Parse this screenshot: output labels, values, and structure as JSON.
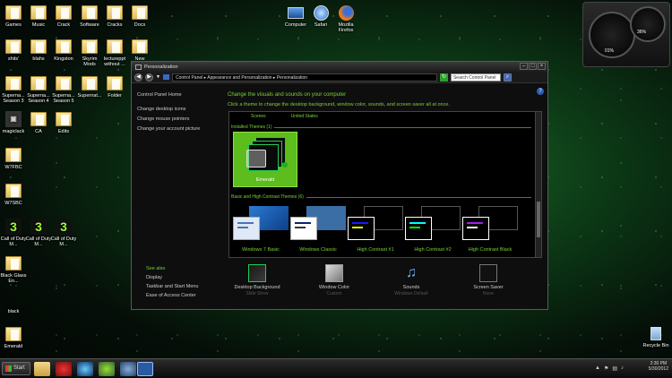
{
  "desktop": {
    "icons": [
      {
        "label": "Games"
      },
      {
        "label": "Music"
      },
      {
        "label": "Crack"
      },
      {
        "label": "Software"
      },
      {
        "label": "Cracks"
      },
      {
        "label": "Docs"
      },
      {
        "label": "shits'"
      },
      {
        "label": "blahs"
      },
      {
        "label": "Kingston"
      },
      {
        "label": "Skyrim Mods"
      },
      {
        "label": "lectureppt without ..."
      },
      {
        "label": "New"
      },
      {
        "label": "Superna... Season 3"
      },
      {
        "label": "Superna... Season 4"
      },
      {
        "label": "Superna... Season 5"
      },
      {
        "label": "Supernat..."
      },
      {
        "label": "Folder"
      },
      {
        "label": "In"
      },
      {
        "label": "magiclack"
      },
      {
        "label": "CA"
      },
      {
        "label": "Edits"
      },
      {
        "label": "W7FBC"
      },
      {
        "label": "W7SBC"
      },
      {
        "label": "Call of Duty M..."
      },
      {
        "label": "Call of Duty M..."
      },
      {
        "label": "Call of Duty M..."
      },
      {
        "label": "Black Glass En..."
      },
      {
        "label": "black"
      },
      {
        "label": "Emerald"
      }
    ],
    "top_apps": [
      {
        "label": "Computer"
      },
      {
        "label": "Safari"
      },
      {
        "label": "Mozilla Firefox"
      }
    ],
    "recycle_bin": "Recycle Bin"
  },
  "gadget": {
    "cpu_pct": "01%",
    "mem_pct": "36%"
  },
  "window": {
    "title": "Personalization",
    "address": "Control Panel  ▸  Appearance and Personalization  ▸  Personalization",
    "search_placeholder": "Search Control Panel",
    "left_pane": {
      "home": "Control Panel Home",
      "links": [
        "Change desktop icons",
        "Change mouse pointers",
        "Change your account picture"
      ]
    },
    "see_also": {
      "heading": "See also",
      "links": [
        "Display",
        "Taskbar and Start Menu",
        "Ease of Access Center"
      ]
    },
    "heading": "Change the visuals and sounds on your computer",
    "subheading": "Click a theme to change the desktop background, window color, sounds, and screen saver all at once.",
    "top_labels": [
      "Scenes",
      "United States"
    ],
    "installed_header": "Installed Themes (1)",
    "installed_theme": "Emerald",
    "basic_header": "Basic and High Contrast Themes (6)",
    "basic_themes": [
      {
        "label": "Windows 7 Basic"
      },
      {
        "label": "Windows Classic"
      },
      {
        "label": "High Contrast #1"
      },
      {
        "label": "High Contrast #2"
      },
      {
        "label": "High Contrast Black"
      }
    ],
    "bottom": [
      {
        "label": "Desktop Background",
        "sub": "Slide Show"
      },
      {
        "label": "Window Color",
        "sub": "Custom"
      },
      {
        "label": "Sounds",
        "sub": "Windows Default"
      },
      {
        "label": "Screen Saver",
        "sub": "None"
      }
    ]
  },
  "taskbar": {
    "start_label": "Start",
    "time": "2:30 PM",
    "date": "5/30/2012"
  }
}
